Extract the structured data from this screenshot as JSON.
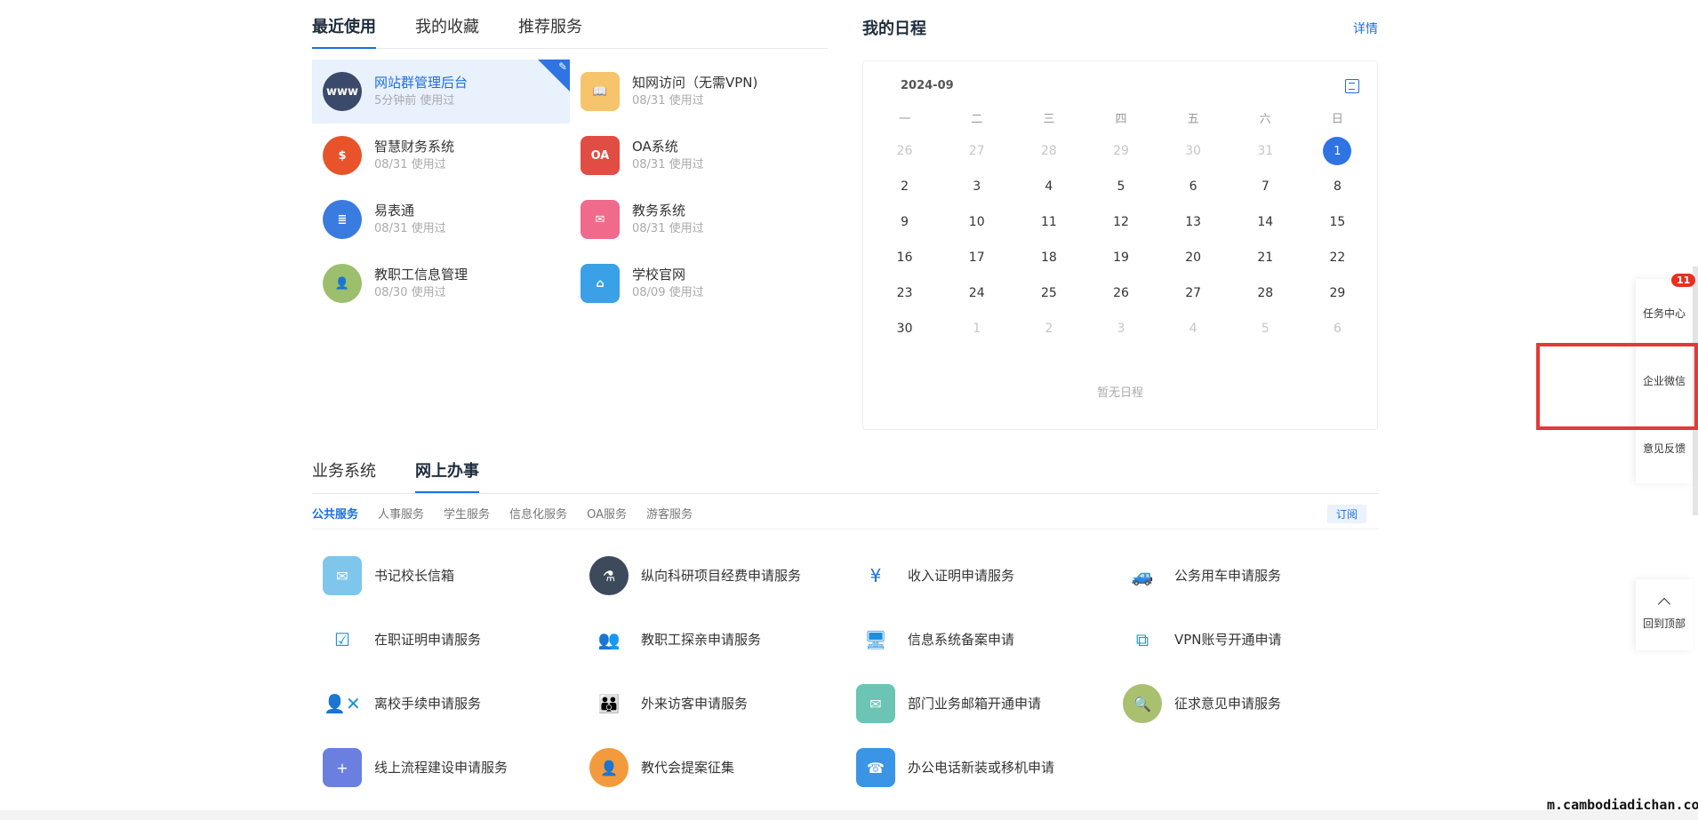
{
  "recent": {
    "tabs": [
      "最近使用",
      "我的收藏",
      "推荐服务"
    ],
    "apps": [
      {
        "name": "网站群管理后台",
        "used": "5分钟前 使用过",
        "icon": "www-globe-icon",
        "glyph": "www",
        "color": "#3b4a6b"
      },
      {
        "name": "知网访问（无需VPN)",
        "used": "08/31 使用过",
        "icon": "book-reader-icon",
        "glyph": "📖",
        "color": "#f6c46a"
      },
      {
        "name": "智慧财务系统",
        "used": "08/31 使用过",
        "icon": "money-icon",
        "glyph": "$",
        "color": "#e8532b"
      },
      {
        "name": "OA系统",
        "used": "08/31 使用过",
        "icon": "oa-mail-icon",
        "glyph": "OA",
        "color": "#e14d43"
      },
      {
        "name": "易表通",
        "used": "08/31 使用过",
        "icon": "form-list-icon",
        "glyph": "≣",
        "color": "#3a7be0"
      },
      {
        "name": "教务系统",
        "used": "08/31 使用过",
        "icon": "envelope-grid-icon",
        "glyph": "✉",
        "color": "#f06b8b"
      },
      {
        "name": "教职工信息管理",
        "used": "08/30 使用过",
        "icon": "id-card-icon",
        "glyph": "👤",
        "color": "#9cbf6e"
      },
      {
        "name": "学校官网",
        "used": "08/09 使用过",
        "icon": "home-upload-icon",
        "glyph": "⌂",
        "color": "#3aa0e8"
      }
    ]
  },
  "schedule": {
    "title": "我的日程",
    "detail_link": "详情",
    "month": "2024-09",
    "weekdays": [
      "一",
      "二",
      "三",
      "四",
      "五",
      "六",
      "日"
    ],
    "days": [
      {
        "d": "26",
        "m": true
      },
      {
        "d": "27",
        "m": true
      },
      {
        "d": "28",
        "m": true
      },
      {
        "d": "29",
        "m": true
      },
      {
        "d": "30",
        "m": true
      },
      {
        "d": "31",
        "m": true
      },
      {
        "d": "1",
        "today": true
      },
      {
        "d": "2"
      },
      {
        "d": "3"
      },
      {
        "d": "4"
      },
      {
        "d": "5"
      },
      {
        "d": "6"
      },
      {
        "d": "7"
      },
      {
        "d": "8"
      },
      {
        "d": "9"
      },
      {
        "d": "10"
      },
      {
        "d": "11"
      },
      {
        "d": "12"
      },
      {
        "d": "13"
      },
      {
        "d": "14"
      },
      {
        "d": "15"
      },
      {
        "d": "16"
      },
      {
        "d": "17"
      },
      {
        "d": "18"
      },
      {
        "d": "19"
      },
      {
        "d": "20"
      },
      {
        "d": "21"
      },
      {
        "d": "22"
      },
      {
        "d": "23"
      },
      {
        "d": "24"
      },
      {
        "d": "25"
      },
      {
        "d": "26"
      },
      {
        "d": "27"
      },
      {
        "d": "28"
      },
      {
        "d": "29"
      },
      {
        "d": "30"
      },
      {
        "d": "1",
        "m": true
      },
      {
        "d": "2",
        "m": true
      },
      {
        "d": "3",
        "m": true
      },
      {
        "d": "4",
        "m": true
      },
      {
        "d": "5",
        "m": true
      },
      {
        "d": "6",
        "m": true
      }
    ],
    "empty_text": "暂无日程"
  },
  "business": {
    "tabs": [
      "业务系统",
      "网上办事"
    ],
    "subtabs": [
      "公共服务",
      "人事服务",
      "学生服务",
      "信息化服务",
      "OA服务",
      "游客服务"
    ],
    "subscribe": "订阅",
    "services": [
      {
        "name": "书记校长信箱",
        "icon": "mailbox-icon",
        "glyph": "✉",
        "style": "sq",
        "color": "#7fc6ec"
      },
      {
        "name": "纵向科研项目经费申请服务",
        "icon": "flask-icon",
        "glyph": "⚗",
        "style": "round",
        "color": "#3d4a5c"
      },
      {
        "name": "收入证明申请服务",
        "icon": "yuan-refresh-icon",
        "glyph": "¥",
        "style": "line",
        "color": "#1d6fe0"
      },
      {
        "name": "公务用车申请服务",
        "icon": "car-icon",
        "glyph": "🚙",
        "style": "line",
        "color": "#1d8fd8"
      },
      {
        "name": "在职证明申请服务",
        "icon": "badge-check-icon",
        "glyph": "☑",
        "style": "line",
        "color": "#1d8fd8"
      },
      {
        "name": "教职工探亲申请服务",
        "icon": "people-icon",
        "glyph": "👥",
        "style": "line",
        "color": "#1d8fd8"
      },
      {
        "name": "信息系统备案申请",
        "icon": "monitor-share-icon",
        "glyph": "🖥",
        "style": "line",
        "color": "#1d8fd8"
      },
      {
        "name": "VPN账号开通申请",
        "icon": "network-icon",
        "glyph": "⧉",
        "style": "line",
        "color": "#1d8fd8"
      },
      {
        "name": "离校手续申请服务",
        "icon": "user-remove-icon",
        "glyph": "👤✕",
        "style": "line",
        "color": "#1d8fd8"
      },
      {
        "name": "外来访客申请服务",
        "icon": "group-icon",
        "glyph": "👪",
        "style": "line",
        "color": "#1d8fd8"
      },
      {
        "name": "部门业务邮箱开通申请",
        "icon": "mail-home-icon",
        "glyph": "✉",
        "style": "sq",
        "color": "#6cc4b4"
      },
      {
        "name": "征求意见申请服务",
        "icon": "document-search-icon",
        "glyph": "🔍",
        "style": "round",
        "color": "#a9c06f"
      },
      {
        "name": "线上流程建设申请服务",
        "icon": "add-book-icon",
        "glyph": "+",
        "style": "sq",
        "color": "#6a7fe0"
      },
      {
        "name": "教代会提案征集",
        "icon": "presentation-icon",
        "glyph": "👤",
        "style": "round",
        "color": "#f39a3c"
      },
      {
        "name": "办公电话新装或移机申请",
        "icon": "phone-icon",
        "glyph": "☎",
        "style": "sq",
        "color": "#3a95e6"
      }
    ]
  },
  "float_bar": {
    "task_label": "任务中心",
    "task_badge": "11",
    "wechat_label": "企业微信",
    "feedback_label": "意见反馈",
    "back_top_label": "回到顶部"
  },
  "watermark": "m.cambodiadichan.co"
}
